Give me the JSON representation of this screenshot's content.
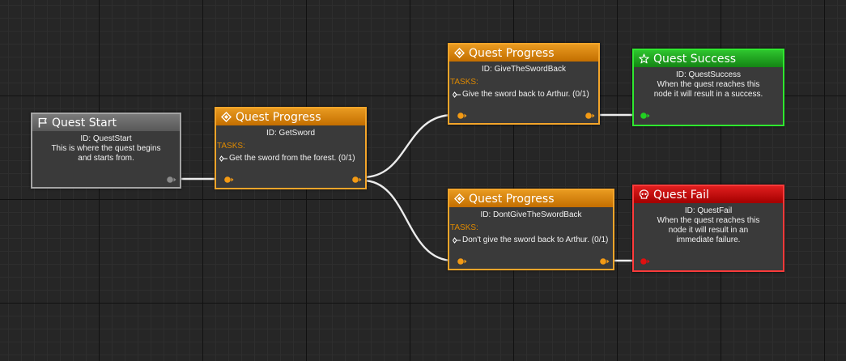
{
  "colors": {
    "progress": "#e08a00",
    "start": "#6a6a6a",
    "success": "#22b022",
    "fail": "#d01010",
    "wire": "#ffffff"
  },
  "nodes": {
    "start": {
      "title": "Quest Start",
      "icon": "flag-icon",
      "id_text": "ID: QuestStart",
      "desc": "This is where the quest begins and starts from."
    },
    "get_sword": {
      "title": "Quest Progress",
      "icon": "diamond-icon",
      "id_text": "ID: GetSword",
      "tasks_label": "TASKS:",
      "task": "Get the sword from the forest. (0/1)"
    },
    "give_back": {
      "title": "Quest Progress",
      "icon": "diamond-icon",
      "id_text": "ID: GiveTheSwordBack",
      "tasks_label": "TASKS:",
      "task": "Give the sword back to Arthur. (0/1)"
    },
    "dont_give_back": {
      "title": "Quest Progress",
      "icon": "diamond-icon",
      "id_text": "ID: DontGiveTheSwordBack",
      "tasks_label": "TASKS:",
      "task": "Don't give the sword back to Arthur. (0/1)"
    },
    "success": {
      "title": "Quest Success",
      "icon": "star-icon",
      "id_text": "ID: QuestSuccess",
      "desc": "When the quest reaches this node it will result in a success."
    },
    "fail": {
      "title": "Quest Fail",
      "icon": "skull-icon",
      "id_text": "ID: QuestFail",
      "desc": "When the quest reaches this node it will result in an immediate failure."
    }
  }
}
